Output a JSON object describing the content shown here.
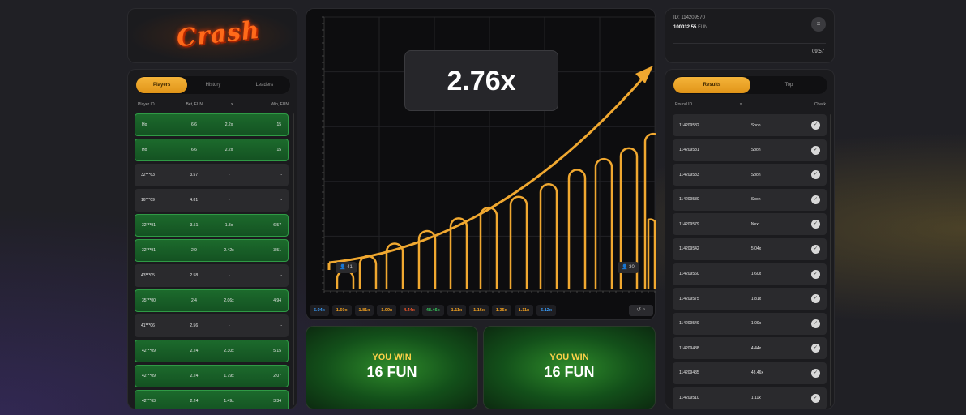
{
  "logo": {
    "text": "Crash"
  },
  "players": {
    "tabs": [
      {
        "label": "Players",
        "active": true
      },
      {
        "label": "History",
        "active": false
      },
      {
        "label": "Leaders",
        "active": false
      }
    ],
    "columns": [
      "Player ID",
      "Bet, FUN",
      "x",
      "Win, FUN"
    ],
    "rows": [
      {
        "id": "Ho",
        "bet": "6.6",
        "mult": "2.2x",
        "win": "15",
        "won": true
      },
      {
        "id": "Ho",
        "bet": "6.6",
        "mult": "2.2x",
        "win": "15",
        "won": true
      },
      {
        "id": "32***63",
        "bet": "3.57",
        "mult": "-",
        "win": "-",
        "won": false
      },
      {
        "id": "16***09",
        "bet": "4.81",
        "mult": "-",
        "win": "-",
        "won": false
      },
      {
        "id": "32***91",
        "bet": "3.51",
        "mult": "1.8x",
        "win": "6.57",
        "won": true
      },
      {
        "id": "32***91",
        "bet": "2.9",
        "mult": "2.42x",
        "win": "3.51",
        "won": true
      },
      {
        "id": "43***05",
        "bet": "2.58",
        "mult": "-",
        "win": "-",
        "won": false
      },
      {
        "id": "35***00",
        "bet": "2.4",
        "mult": "2.06x",
        "win": "4.94",
        "won": true
      },
      {
        "id": "41***06",
        "bet": "2.56",
        "mult": "-",
        "win": "-",
        "won": false
      },
      {
        "id": "42***09",
        "bet": "2.24",
        "mult": "2.30x",
        "win": "5.15",
        "won": true
      },
      {
        "id": "42***09",
        "bet": "2.24",
        "mult": "1.79x",
        "win": "2.07",
        "won": true
      },
      {
        "id": "42***63",
        "bet": "2.24",
        "mult": "1.49x",
        "win": "3.34",
        "won": true
      }
    ]
  },
  "game": {
    "multiplier": "2.76x",
    "left_badge": "41",
    "right_badge": "30",
    "bar_levels": [
      0.32,
      0.45,
      0.58,
      0.72,
      0.86,
      1.0
    ],
    "history": [
      {
        "label": "5.04x",
        "color": "#3aa0ff"
      },
      {
        "label": "1.60x",
        "color": "#f0a020"
      },
      {
        "label": "1.81x",
        "color": "#f0a020"
      },
      {
        "label": "1.09x",
        "color": "#f0a020"
      },
      {
        "label": "4.44x",
        "color": "#ff5a2a"
      },
      {
        "label": "48.46x",
        "color": "#38d060"
      },
      {
        "label": "1.11x",
        "color": "#f0a020"
      },
      {
        "label": "1.16x",
        "color": "#f0a020"
      },
      {
        "label": "1.35x",
        "color": "#f0a020"
      },
      {
        "label": "1.11x",
        "color": "#f0a020"
      },
      {
        "label": "5.12x",
        "color": "#3aa0ff"
      }
    ],
    "history_ctrl": "↺ ⌕"
  },
  "wins": [
    {
      "title": "YOU WIN",
      "amount": "16 FUN"
    },
    {
      "title": "YOU WIN",
      "amount": "16 FUN"
    }
  ],
  "user": {
    "id": "ID: 114209570",
    "balance": "100032.55",
    "currency": "FUN",
    "menu_icon": "≡",
    "time": "09:57"
  },
  "results": {
    "tabs": [
      {
        "label": "Results",
        "active": true
      },
      {
        "label": "Top",
        "active": false
      }
    ],
    "columns": [
      "Round ID",
      "x",
      "Check"
    ],
    "rows": [
      {
        "id": "114209582",
        "value": "Soon"
      },
      {
        "id": "114209581",
        "value": "Soon"
      },
      {
        "id": "114209583",
        "value": "Soon"
      },
      {
        "id": "114209580",
        "value": "Soon"
      },
      {
        "id": "114209579",
        "value": "Next"
      },
      {
        "id": "114209542",
        "value": "5.04x"
      },
      {
        "id": "114209560",
        "value": "1.60x"
      },
      {
        "id": "114209575",
        "value": "1.81x"
      },
      {
        "id": "114209549",
        "value": "1.09x"
      },
      {
        "id": "114209438",
        "value": "4.44x"
      },
      {
        "id": "114209435",
        "value": "48.46x"
      },
      {
        "id": "114209510",
        "value": "1.11x"
      }
    ],
    "check_icon": "✓"
  }
}
